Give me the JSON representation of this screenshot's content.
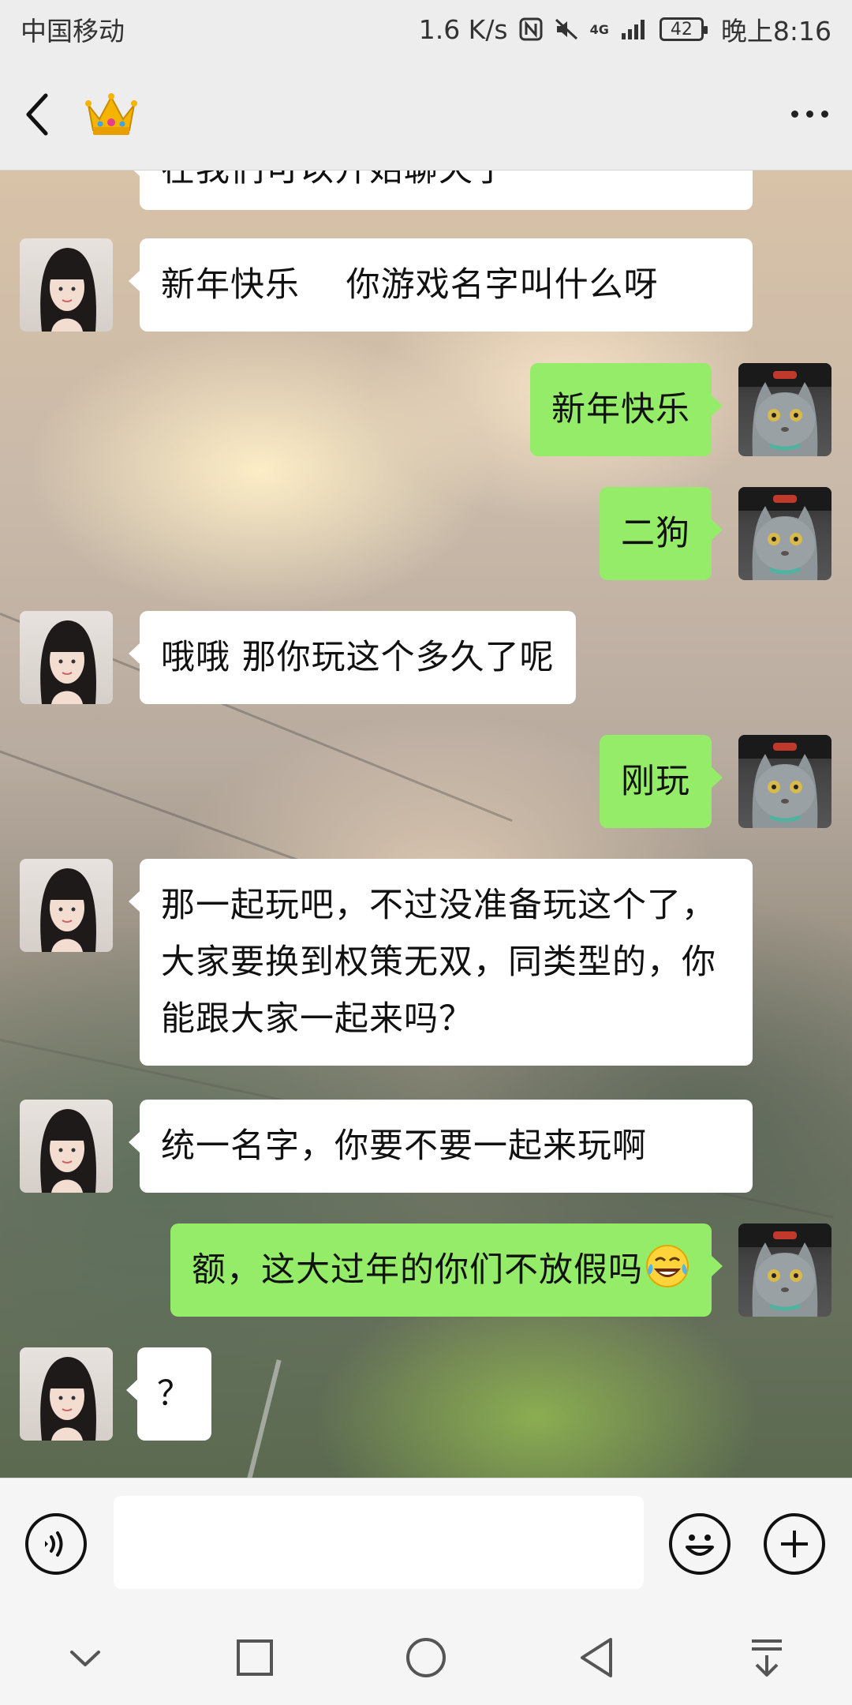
{
  "status_bar": {
    "carrier": "中国移动",
    "speed": "1.6 K/s",
    "network": "4G",
    "battery": "42",
    "time": "晚上8:16"
  },
  "header": {
    "back_icon": "chevron-left-icon",
    "title_icon": "crown-icon",
    "more_icon": "more-dots-icon"
  },
  "messages": [
    {
      "side": "in",
      "text": "在我们可以开始聊天了"
    },
    {
      "side": "in",
      "text": "新年快乐　 你游戏名字叫什么呀"
    },
    {
      "side": "out",
      "text": "新年快乐"
    },
    {
      "side": "out",
      "text": "二狗"
    },
    {
      "side": "in",
      "text": "哦哦  那你玩这个多久了呢"
    },
    {
      "side": "out",
      "text": "刚玩"
    },
    {
      "side": "in",
      "text": "那一起玩吧，不过没准备玩这个了，大家要换到权策无双，同类型的，你能跟大家一起来吗？"
    },
    {
      "side": "in",
      "text": "统一名字，你要不要一起来玩啊"
    },
    {
      "side": "out",
      "text": "额，这大过年的你们不放假吗"
    },
    {
      "side": "in",
      "text": "？"
    }
  ],
  "input_bar": {
    "voice_icon": "voice-icon",
    "emoji_icon": "emoji-icon",
    "plus_icon": "plus-icon",
    "text_value": ""
  },
  "nav_bar": {
    "icons": [
      "chevron-down-icon",
      "square-icon",
      "circle-icon",
      "back-triangle-icon",
      "download-icon"
    ]
  }
}
